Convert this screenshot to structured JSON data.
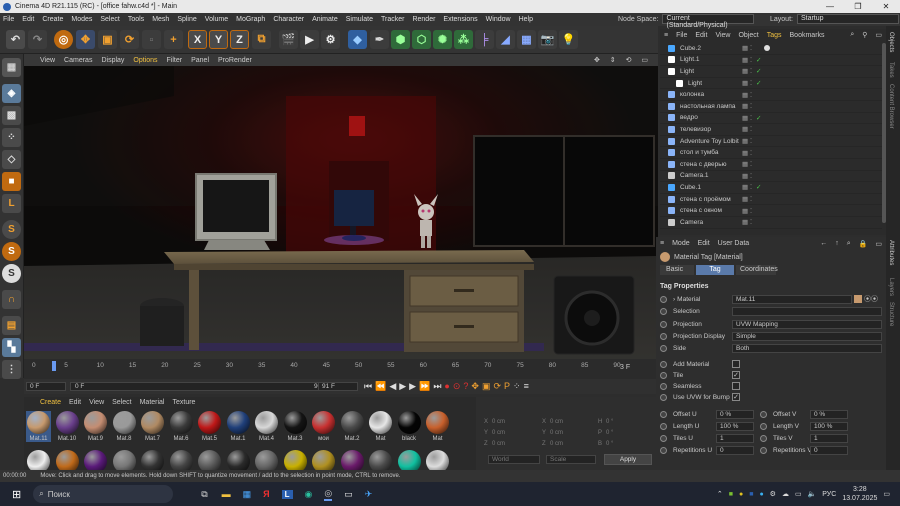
{
  "titlebar": {
    "title": "Cinema 4D R21.115 (RC) - [office fahw.c4d *] - Main",
    "minimize": "—",
    "maximize": "❐",
    "close": "✕"
  },
  "menubar": {
    "items": [
      "File",
      "Edit",
      "Create",
      "Modes",
      "Select",
      "Tools",
      "Mesh",
      "Spline",
      "Volume",
      "MoGraph",
      "Character",
      "Animate",
      "Simulate",
      "Tracker",
      "Render",
      "Extensions",
      "Window",
      "Help"
    ],
    "node_space_label": "Node Space:",
    "node_space_value": "Current (Standard/Physical)",
    "layout_label": "Layout:",
    "layout_value": "Startup"
  },
  "toolbar": {
    "axis_x": "X",
    "axis_y": "Y",
    "axis_z": "Z"
  },
  "left_tools": {
    "s1": "S",
    "s2": "S",
    "s3": "S"
  },
  "viewport_menu": {
    "items": [
      "View",
      "Cameras",
      "Display",
      "Options",
      "Filter",
      "Panel",
      "ProRender"
    ]
  },
  "timeline": {
    "ticks": [
      "0",
      "5",
      "10",
      "15",
      "20",
      "25",
      "30",
      "35",
      "40",
      "45",
      "50",
      "55",
      "60",
      "65",
      "70",
      "75",
      "80",
      "85",
      "90"
    ],
    "current_frame": "3 F"
  },
  "transport": {
    "start": "0 F",
    "current": "0 F",
    "end": "90 F",
    "fps": "91 F"
  },
  "material_manager": {
    "menu": [
      "Create",
      "Edit",
      "View",
      "Select",
      "Material",
      "Texture"
    ],
    "row1": [
      {
        "name": "Mat.11",
        "color": "#c79a6e"
      },
      {
        "name": "Mat.10",
        "color": "#6a3f8c"
      },
      {
        "name": "Mat.9",
        "color": "#c48d72"
      },
      {
        "name": "Mat.8",
        "color": "#9a9a9a"
      },
      {
        "name": "Mat.7",
        "color": "#b08a63"
      },
      {
        "name": "Mat.6",
        "color": "#3a3a3a"
      },
      {
        "name": "Mat.5",
        "color": "#c01818"
      },
      {
        "name": "Mat.1",
        "color": "#1f3f7a"
      },
      {
        "name": "Mat.4",
        "color": "#d8d8d8"
      },
      {
        "name": "Mat.3",
        "color": "#141414"
      },
      {
        "name": "мои",
        "color": "#c83030"
      },
      {
        "name": "Mat.2",
        "color": "#4a4a4a"
      },
      {
        "name": "Mat",
        "color": "#e6e6e6"
      },
      {
        "name": "black",
        "color": "#050505"
      },
      {
        "name": "Mat",
        "color": "#c8602c"
      }
    ],
    "row2": [
      {
        "color": "#eeeeee"
      },
      {
        "color": "#c06a1a"
      },
      {
        "color": "#5a1a7a"
      },
      {
        "color": "#777777"
      },
      {
        "color": "#333333"
      },
      {
        "color": "#444444"
      },
      {
        "color": "#5a5a5a"
      },
      {
        "color": "#2a2a2a"
      },
      {
        "color": "#666666"
      },
      {
        "color": "#c8b000"
      },
      {
        "color": "#b09020"
      },
      {
        "color": "#6a1a6a"
      },
      {
        "color": "#4a4a4a"
      },
      {
        "color": "#10c0a0"
      },
      {
        "color": "#dddddd"
      }
    ]
  },
  "coords": {
    "x": "X",
    "y": "Y",
    "z": "Z",
    "h": "H",
    "p": "P",
    "b": "B",
    "pos": "0 cm",
    "rot": "0 °",
    "world": "World",
    "scale": "Scale",
    "apply": "Apply"
  },
  "object_manager": {
    "menu": [
      "File",
      "Edit",
      "View",
      "Object",
      "Tags",
      "Bookmarks"
    ],
    "objects": [
      {
        "name": "Cube.2",
        "icon_color": "#4aa8ff",
        "indent": 0
      },
      {
        "name": "Light.1",
        "icon_color": "#ffffff",
        "indent": 0
      },
      {
        "name": "Light",
        "icon_color": "#ffffff",
        "indent": 0
      },
      {
        "name": "Light",
        "icon_color": "#ffffff",
        "indent": 1
      },
      {
        "name": "колонка",
        "icon_color": "#8ab4f8",
        "indent": 0
      },
      {
        "name": "настольная лампа",
        "icon_color": "#8ab4f8",
        "indent": 0
      },
      {
        "name": "ведро",
        "icon_color": "#8ab4f8",
        "indent": 0
      },
      {
        "name": "телевизор",
        "icon_color": "#8ab4f8",
        "indent": 0
      },
      {
        "name": "Adventure Toy Lolbit",
        "icon_color": "#8ab4f8",
        "indent": 0
      },
      {
        "name": "стол и тумба",
        "icon_color": "#8ab4f8",
        "indent": 0
      },
      {
        "name": "стена с дверью",
        "icon_color": "#8ab4f8",
        "indent": 0
      },
      {
        "name": "Camera.1",
        "icon_color": "#cccccc",
        "indent": 0
      },
      {
        "name": "Cube.1",
        "icon_color": "#4aa8ff",
        "indent": 0
      },
      {
        "name": "стена с проёмом",
        "icon_color": "#8ab4f8",
        "indent": 0
      },
      {
        "name": "стена с окном",
        "icon_color": "#8ab4f8",
        "indent": 0
      },
      {
        "name": "Camera",
        "icon_color": "#cccccc",
        "indent": 0
      }
    ]
  },
  "attributes": {
    "menu": [
      "Mode",
      "Edit",
      "User Data"
    ],
    "title": "Material Tag [Material]",
    "tabs": [
      "Basic",
      "Tag",
      "Coordinates"
    ],
    "section": "Tag Properties",
    "material_label": "Material",
    "material_value": "Mat.11",
    "selection_label": "Selection",
    "projection_label": "Projection",
    "projection_value": "UVW Mapping",
    "projection_display_label": "Projection Display",
    "projection_display_value": "Simple",
    "side_label": "Side",
    "side_value": "Both",
    "add_material_label": "Add Material",
    "tile_label": "Tile",
    "seamless_label": "Seamless",
    "use_uvw_label": "Use UVW for Bump",
    "offset_u_label": "Offset U",
    "offset_u": "0 %",
    "offset_v_label": "Offset V",
    "offset_v": "0 %",
    "length_u_label": "Length U",
    "length_u": "100 %",
    "length_v_label": "Length V",
    "length_v": "100 %",
    "tiles_u_label": "Tiles U",
    "tiles_u": "1",
    "tiles_v_label": "Tiles V",
    "tiles_v": "1",
    "rep_u_label": "Repetitions U",
    "rep_u": "0",
    "rep_v_label": "Repetitions V",
    "rep_v": "0"
  },
  "right_strip": [
    "Objects",
    "Takes",
    "Content Browser",
    "Attributes",
    "Layers",
    "Structure"
  ],
  "statusbar": {
    "time": "00:00:00",
    "message": "Move: Click and drag to move elements. Hold down SHIFT to quantize movement / add to the selection in point mode, CTRL to remove."
  },
  "taskbar": {
    "search": "Поиск",
    "time": "3:28",
    "date": "13.07.2025",
    "lang": "РУС"
  }
}
